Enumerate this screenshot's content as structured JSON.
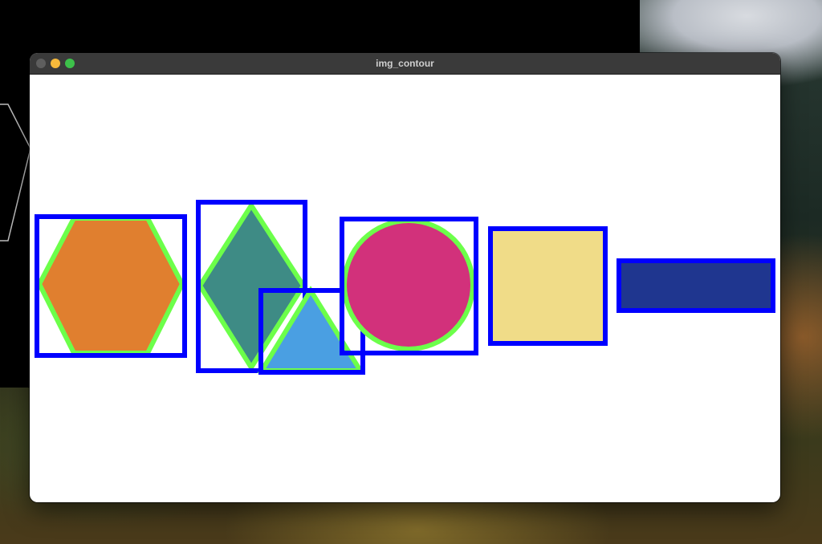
{
  "window": {
    "title": "img_contour"
  },
  "canvas": {
    "shapes": [
      {
        "name": "hexagon",
        "fill": "#e07f2f",
        "contour_color": "#6cff4a",
        "box_color": "#0000ff"
      },
      {
        "name": "diamond",
        "fill": "#3e8b85",
        "contour_color": "#6cff4a",
        "box_color": "#0000ff"
      },
      {
        "name": "triangle",
        "fill": "#4a9fe2",
        "contour_color": "#6cff4a",
        "box_color": "#0000ff"
      },
      {
        "name": "circle",
        "fill": "#d2317b",
        "contour_color": "#6cff4a",
        "box_color": "#0000ff"
      },
      {
        "name": "square",
        "fill": "#f0dc88",
        "contour_color": "#6cff4a",
        "box_color": "#0000ff"
      },
      {
        "name": "rectangle",
        "fill": "#1f368f",
        "contour_color": "#6cff4a",
        "box_color": "#0000ff"
      }
    ]
  },
  "colors": {
    "titlebar": "#3a3a3a",
    "close": "#5e5e5e",
    "minimize": "#f6b93b",
    "maximize": "#3dc04a"
  }
}
